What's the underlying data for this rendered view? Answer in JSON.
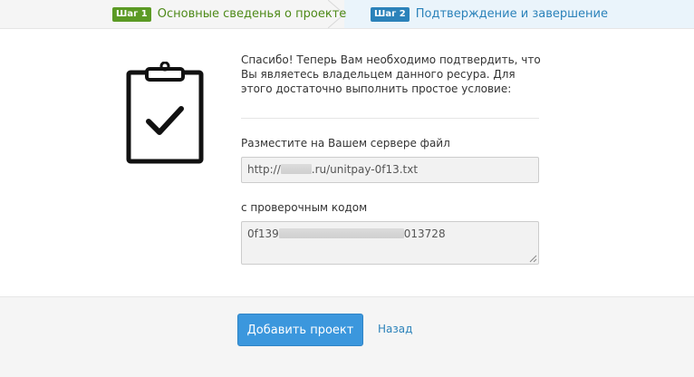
{
  "steps": [
    {
      "badge": "Шаг 1",
      "label": "Основные сведенья о проекте"
    },
    {
      "badge": "Шаг 2",
      "label": "Подтверждение и завершение"
    }
  ],
  "content": {
    "intro_text": "Спасибо! Теперь Вам необходимо подтвердить, что Вы являетесь владельцем данного ресура. Для этого достаточно выполнить простое условие:",
    "file_label": "Разместите на Вашем сервере файл",
    "file_value_prefix": "http://",
    "file_value_suffix": ".ru/unitpay-0f13.txt",
    "code_label": "с проверочным кодом",
    "code_value_prefix": "0f139",
    "code_value_suffix": "013728"
  },
  "footer": {
    "submit_label": "Добавить проект",
    "back_label": "Назад"
  },
  "icons": {
    "clipboard": "clipboard-check-icon"
  },
  "colors": {
    "step1": "#5b9a24",
    "step2": "#2b82ba",
    "primary_button": "#3b97dd"
  }
}
